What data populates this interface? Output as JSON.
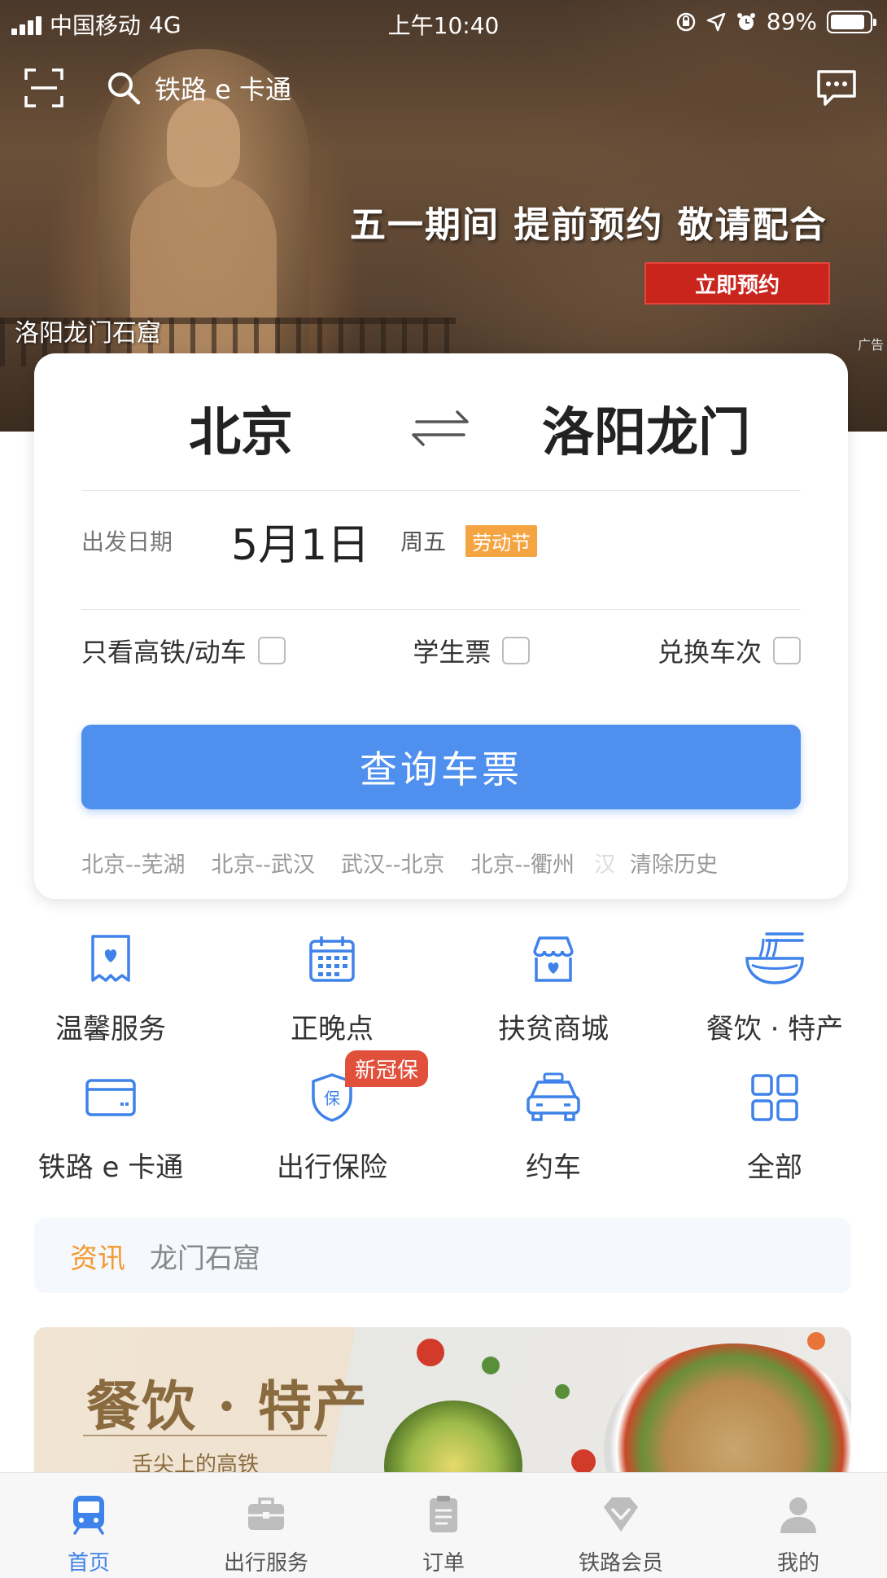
{
  "status_bar": {
    "carrier": "中国移动",
    "network": "4G",
    "time": "上午10:40",
    "battery": "89%",
    "battery_level": 0.89
  },
  "topbar": {
    "search_text": "铁路 e 卡通"
  },
  "banner": {
    "headline": "五一期间 提前预约 敬请配合",
    "cta": "立即预约",
    "place": "洛阳龙门石窟",
    "ad_tag": "广告"
  },
  "ticket": {
    "from": "北京",
    "to": "洛阳龙门",
    "date_label": "出发日期",
    "date": "5月1日",
    "weekday": "周五",
    "holiday": "劳动节",
    "options": [
      {
        "label": "只看高铁/动车",
        "checked": false
      },
      {
        "label": "学生票",
        "checked": false
      },
      {
        "label": "兑换车次",
        "checked": false
      }
    ],
    "query_button": "查询车票",
    "history": [
      "北京--芜湖",
      "北京--武汉",
      "武汉--北京",
      "北京--衢州"
    ],
    "history_fade": "汉",
    "clear_history": "清除历史"
  },
  "services": [
    {
      "label": "温馨服务",
      "icon": "warm-service-icon"
    },
    {
      "label": "正晚点",
      "icon": "calendar-icon"
    },
    {
      "label": "扶贫商城",
      "icon": "shop-icon"
    },
    {
      "label": "餐饮 · 特产",
      "icon": "noodle-bowl-icon"
    },
    {
      "label": "铁路 e 卡通",
      "icon": "card-icon"
    },
    {
      "label": "出行保险",
      "icon": "shield-icon",
      "badge": "新冠保"
    },
    {
      "label": "约车",
      "icon": "car-icon"
    },
    {
      "label": "全部",
      "icon": "grid-icon"
    }
  ],
  "news": {
    "tag": "资讯",
    "text": "龙门石窟"
  },
  "food_banner": {
    "title": "餐饮 · 特产",
    "subtitle": "舌尖上的高铁"
  },
  "tabs": [
    {
      "label": "首页",
      "icon": "train-icon",
      "active": true
    },
    {
      "label": "出行服务",
      "icon": "briefcase-icon",
      "active": false
    },
    {
      "label": "订单",
      "icon": "clipboard-icon",
      "active": false
    },
    {
      "label": "铁路会员",
      "icon": "diamond-icon",
      "active": false
    },
    {
      "label": "我的",
      "icon": "person-icon",
      "active": false
    }
  ],
  "colors": {
    "accent": "#4f90ef",
    "tab_active": "#3e82ea",
    "holiday_tag": "#f5a442",
    "news_tag": "#f39a2e",
    "badge": "#e0503a",
    "cta": "#c9251d"
  }
}
